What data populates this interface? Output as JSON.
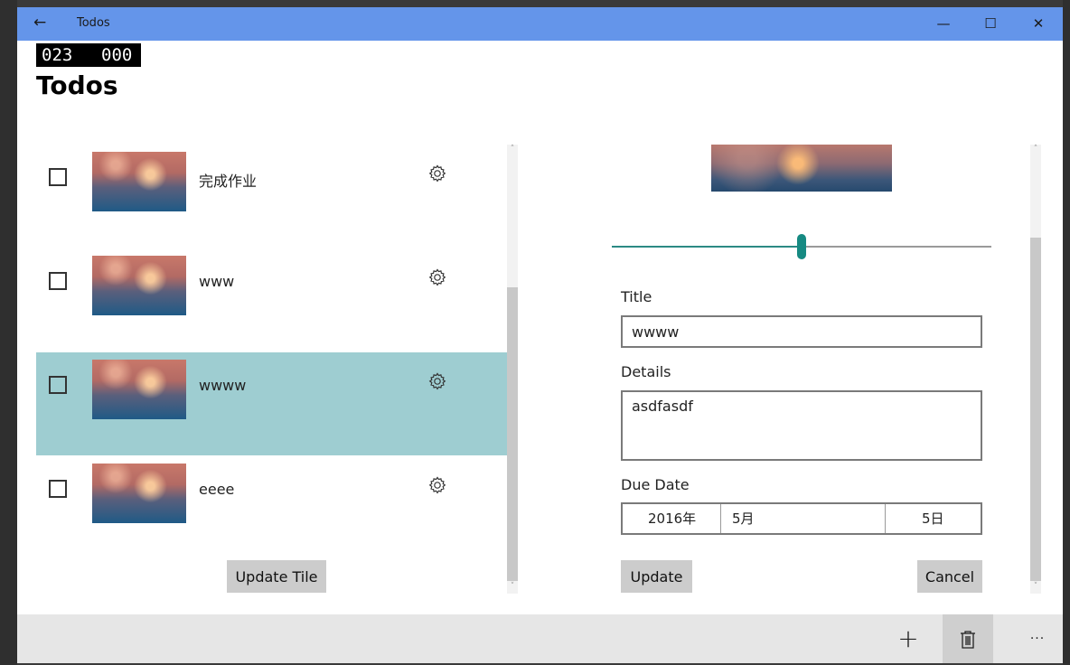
{
  "window": {
    "back_glyph": "←",
    "title": "Todos",
    "minimize": "—",
    "maximize": "☐",
    "close": "✕"
  },
  "counter": {
    "left": "023",
    "right": "000"
  },
  "page_title": "Todos",
  "todo_list": {
    "items": [
      {
        "text": "完成作业",
        "checked": false,
        "selected": false
      },
      {
        "text": "www",
        "checked": false,
        "selected": false
      },
      {
        "text": "wwww",
        "checked": false,
        "selected": true
      },
      {
        "text": "eeee",
        "checked": false,
        "selected": false
      }
    ],
    "update_tile_label": "Update Tile",
    "scroll_up": "˄",
    "scroll_down": "˅"
  },
  "detail": {
    "slider_value_fraction": 0.5,
    "title_label": "Title",
    "title_value": "wwww",
    "details_label": "Details",
    "details_value": "asdfasdf",
    "due_date_label": "Due Date",
    "due_date": {
      "year": "2016年",
      "month": "5月",
      "day": "5日"
    },
    "update_label": "Update",
    "cancel_label": "Cancel",
    "scroll_up": "˄",
    "scroll_down": "˅"
  },
  "appbar": {
    "add_glyph": "+",
    "more_glyph": "···"
  },
  "colors": {
    "titlebar": "#6495ea",
    "selected_row": "#9ecdd1",
    "slider_accent": "#168a82"
  }
}
